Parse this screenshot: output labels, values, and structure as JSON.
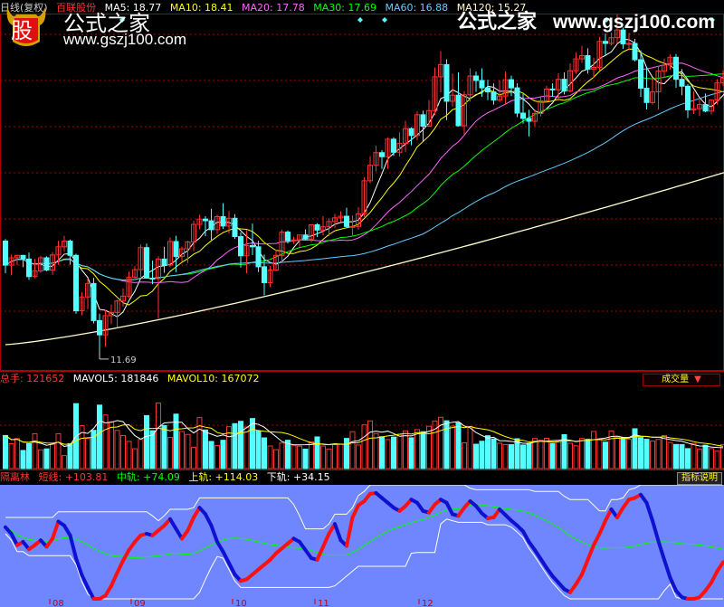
{
  "chart_header": {
    "period": "日线(复权)",
    "stock": "百联股份",
    "ma": [
      {
        "label": "MA5: 18.77",
        "color": "#ffffff"
      },
      {
        "label": "MA10: 18.41",
        "color": "#ffff00"
      },
      {
        "label": "MA20: 17.78",
        "color": "#ff66ff"
      },
      {
        "label": "MA30: 17.69",
        "color": "#00ff00"
      },
      {
        "label": "MA60: 16.88",
        "color": "#66ccff"
      },
      {
        "label": "MA120: 15.27",
        "color": "#ffffcc"
      }
    ]
  },
  "low_label": "11.69",
  "volume_header": {
    "total": "总手: 121652",
    "mavol5": "MAVOL5: 181846",
    "mavol10": "MAVOL10: 167072",
    "tab": "成交量"
  },
  "indicator_header": {
    "name": "隔离林",
    "short": "短线: +103.81",
    "mid": "中轨: +74.09",
    "upper": "上轨: +114.03",
    "lower": "下轨: +34.15",
    "help": "指标说明"
  },
  "x_ticks": [
    "08",
    "09",
    "10",
    "11",
    "12"
  ],
  "watermark": {
    "top_cn": "公式之家",
    "top_url": "www.gszj100.com",
    "logo": "股",
    "bottom_cn": "公式之家",
    "bottom_url": "www.gszj100.com"
  },
  "colors": {
    "up": "#ff3333",
    "down": "#54ffff",
    "grid": "#aa0000",
    "indicator_bg": "#6f86ff"
  },
  "chart_data": {
    "type": "candlestick",
    "ylim": [
      11.2,
      19.9
    ],
    "low_mark": 11.69,
    "ohlc": [
      [
        14.34,
        14.39,
        13.55,
        13.75
      ],
      [
        13.75,
        14.01,
        13.5,
        13.93
      ],
      [
        13.93,
        14.0,
        13.75,
        13.99
      ],
      [
        13.99,
        14.0,
        13.7,
        13.9
      ],
      [
        13.9,
        14.06,
        13.39,
        13.47
      ],
      [
        13.47,
        13.9,
        13.43,
        13.61
      ],
      [
        13.61,
        13.98,
        13.56,
        13.93
      ],
      [
        13.93,
        13.97,
        13.6,
        13.63
      ],
      [
        13.63,
        14.07,
        13.51,
        14.0
      ],
      [
        14.0,
        14.35,
        13.76,
        14.2
      ],
      [
        14.2,
        14.47,
        14.08,
        14.34
      ],
      [
        14.34,
        14.38,
        13.76,
        13.99
      ],
      [
        13.99,
        14.03,
        12.56,
        12.63
      ],
      [
        12.63,
        13.09,
        12.52,
        12.97
      ],
      [
        12.97,
        13.43,
        12.67,
        13.3
      ],
      [
        13.3,
        13.44,
        12.32,
        12.39
      ],
      [
        12.39,
        12.56,
        11.69,
        12.04
      ],
      [
        12.04,
        12.66,
        11.75,
        12.51
      ],
      [
        12.51,
        12.78,
        12.3,
        12.59
      ],
      [
        12.59,
        12.9,
        12.23,
        12.87
      ],
      [
        12.87,
        13.18,
        12.73,
        12.99
      ],
      [
        12.99,
        13.59,
        12.94,
        13.45
      ],
      [
        13.45,
        13.73,
        13.42,
        13.64
      ],
      [
        13.64,
        14.26,
        13.46,
        14.18
      ],
      [
        14.18,
        14.28,
        13.42,
        13.43
      ],
      [
        13.43,
        13.86,
        13.28,
        13.42
      ],
      [
        13.42,
        13.97,
        12.44,
        13.9
      ],
      [
        13.9,
        14.2,
        13.56,
        13.75
      ],
      [
        13.75,
        14.43,
        13.7,
        14.33
      ],
      [
        14.33,
        14.47,
        13.58,
        13.96
      ],
      [
        13.96,
        14.21,
        13.84,
        14.15
      ],
      [
        14.15,
        14.35,
        13.8,
        14.32
      ],
      [
        14.32,
        14.84,
        14.09,
        14.75
      ],
      [
        14.75,
        14.99,
        14.63,
        14.88
      ],
      [
        14.88,
        14.95,
        14.46,
        14.84
      ],
      [
        14.84,
        15.13,
        14.37,
        14.62
      ],
      [
        14.62,
        14.99,
        14.52,
        14.94
      ],
      [
        14.94,
        15.27,
        14.64,
        14.71
      ],
      [
        14.71,
        15.08,
        14.52,
        14.9
      ],
      [
        14.9,
        15.0,
        14.39,
        14.45
      ],
      [
        14.45,
        14.55,
        13.69,
        13.98
      ],
      [
        13.98,
        14.61,
        13.55,
        14.23
      ],
      [
        14.23,
        14.77,
        14.0,
        14.2
      ],
      [
        14.2,
        14.35,
        13.58,
        13.71
      ],
      [
        13.71,
        14.01,
        13.01,
        13.32
      ],
      [
        13.32,
        13.73,
        13.21,
        13.63
      ],
      [
        13.63,
        14.13,
        13.6,
        13.99
      ],
      [
        13.99,
        14.62,
        13.8,
        14.56
      ],
      [
        14.56,
        14.6,
        14.28,
        14.35
      ],
      [
        14.35,
        14.45,
        14.27,
        14.37
      ],
      [
        14.37,
        14.49,
        14.2,
        14.49
      ],
      [
        14.49,
        14.63,
        14.36,
        14.39
      ],
      [
        14.39,
        14.75,
        14.31,
        14.74
      ],
      [
        14.74,
        14.78,
        14.44,
        14.61
      ],
      [
        14.61,
        14.95,
        14.48,
        14.69
      ],
      [
        14.69,
        14.9,
        14.46,
        14.82
      ],
      [
        14.82,
        15.01,
        14.66,
        14.91
      ],
      [
        14.91,
        15.07,
        14.81,
        14.95
      ],
      [
        14.95,
        15.16,
        14.68,
        14.7
      ],
      [
        14.7,
        14.97,
        14.48,
        14.7
      ],
      [
        14.7,
        15.17,
        14.62,
        15.01
      ],
      [
        15.01,
        15.91,
        14.93,
        15.82
      ],
      [
        15.82,
        16.42,
        15.76,
        16.2
      ],
      [
        16.2,
        16.68,
        16.05,
        16.51
      ],
      [
        16.51,
        16.57,
        16.11,
        16.41
      ],
      [
        16.41,
        16.88,
        16.11,
        16.84
      ],
      [
        16.84,
        16.89,
        16.43,
        16.52
      ],
      [
        16.52,
        17.01,
        16.41,
        16.74
      ],
      [
        16.74,
        17.29,
        16.52,
        17.1
      ],
      [
        17.1,
        17.13,
        16.69,
        16.93
      ],
      [
        16.93,
        17.53,
        16.81,
        17.44
      ],
      [
        17.44,
        17.54,
        16.77,
        17.16
      ],
      [
        17.16,
        17.8,
        17.14,
        17.54
      ],
      [
        17.54,
        18.6,
        17.44,
        18.37
      ],
      [
        18.37,
        19.0,
        17.99,
        18.67
      ],
      [
        18.67,
        18.8,
        17.31,
        17.77
      ],
      [
        17.77,
        18.45,
        17.64,
        17.92
      ],
      [
        17.92,
        18.48,
        17.15,
        17.17
      ],
      [
        17.17,
        18.02,
        16.95,
        17.93
      ],
      [
        17.93,
        18.58,
        17.76,
        18.39
      ],
      [
        18.39,
        18.5,
        18.0,
        18.28
      ],
      [
        18.28,
        18.58,
        17.88,
        18.1
      ],
      [
        18.1,
        18.3,
        17.8,
        18.0
      ],
      [
        18.0,
        18.21,
        17.69,
        17.8
      ],
      [
        17.8,
        18.29,
        17.75,
        17.9
      ],
      [
        17.9,
        18.5,
        17.7,
        18.3
      ],
      [
        18.3,
        18.4,
        17.9,
        18.1
      ],
      [
        18.1,
        18.21,
        17.38,
        17.48
      ],
      [
        17.48,
        17.95,
        17.22,
        17.35
      ],
      [
        17.35,
        17.56,
        16.91,
        17.28
      ],
      [
        17.28,
        17.57,
        17.16,
        17.47
      ],
      [
        17.47,
        17.9,
        17.4,
        17.78
      ],
      [
        17.78,
        18.15,
        17.73,
        18.07
      ],
      [
        18.07,
        18.21,
        17.88,
        18.05
      ],
      [
        18.05,
        18.46,
        17.78,
        18.31
      ],
      [
        18.31,
        18.48,
        17.94,
        18.02
      ],
      [
        18.02,
        18.7,
        17.99,
        18.52
      ],
      [
        18.52,
        18.97,
        18.45,
        18.81
      ],
      [
        18.81,
        19.13,
        18.71,
        18.89
      ],
      [
        18.89,
        19.07,
        18.45,
        18.56
      ],
      [
        18.56,
        18.84,
        18.34,
        18.6
      ],
      [
        18.6,
        19.35,
        18.53,
        19.24
      ],
      [
        19.24,
        19.43,
        18.91,
        19.19
      ],
      [
        19.19,
        19.46,
        19.14,
        19.33
      ],
      [
        19.33,
        19.91,
        19.18,
        19.52
      ],
      [
        19.52,
        19.58,
        19.06,
        19.18
      ],
      [
        19.18,
        19.45,
        19.02,
        19.19
      ],
      [
        19.19,
        19.3,
        18.75,
        18.79
      ],
      [
        18.79,
        19.02,
        17.88,
        18.09
      ],
      [
        18.09,
        18.6,
        17.57,
        17.74
      ],
      [
        17.74,
        18.35,
        17.69,
        18.0
      ],
      [
        18.0,
        18.64,
        17.57,
        18.51
      ],
      [
        18.51,
        18.82,
        18.37,
        18.66
      ],
      [
        18.66,
        18.92,
        18.55,
        18.85
      ],
      [
        18.85,
        18.93,
        18.1,
        18.31
      ],
      [
        18.31,
        18.56,
        17.92,
        18.14
      ],
      [
        18.14,
        18.19,
        17.36,
        17.56
      ],
      [
        17.56,
        18.02,
        17.46,
        17.59
      ],
      [
        17.59,
        17.81,
        17.41,
        17.69
      ],
      [
        17.69,
        17.96,
        17.5,
        17.53
      ],
      [
        17.53,
        17.82,
        17.45,
        17.8
      ],
      [
        17.8,
        18.31,
        17.69,
        18.22
      ],
      [
        18.22,
        18.53,
        18.14,
        18.34
      ],
      [
        18.34,
        18.67,
        18.32,
        18.64
      ],
      [
        18.64,
        18.9,
        18.51,
        18.77
      ]
    ],
    "ma120_range": [
      11.8,
      16.1
    ],
    "volume": {
      "ylim": [
        0,
        420000
      ],
      "values": [
        167040,
        125560,
        151560,
        91480,
        126120,
        176000,
        94440,
        99480,
        122840,
        176000,
        65680,
        126120,
        327920,
        216720,
        151560,
        193080,
        320320,
        270680,
        234480,
        192600,
        166560,
        137240,
        100160,
        147320,
        267480,
        191200,
        330720,
        217240,
        157240,
        275000,
        187280,
        172400,
        107920,
        257520,
        195040,
        137080,
        116640,
        143040,
        211520,
        226880,
        238480,
        210000,
        252600,
        189280,
        155000,
        114120,
        95480,
        128840,
        143240,
        118280,
        113120,
        98160,
        135120,
        159960,
        113760,
        98760,
        120680,
        123440,
        152240,
        186360,
        118880,
        220680,
        240800,
        177120,
        160560,
        146400,
        159120,
        173280,
        190640,
        155520,
        196680,
        186120,
        213520,
        240120,
        259000,
        241320,
        214280,
        230840,
        130080,
        212400,
        123000,
        138120,
        166000,
        149600,
        128400,
        120800,
        121000,
        150680,
        119000,
        128000,
        152000,
        143200,
        153200,
        127000,
        137360,
        171200,
        128000,
        115000,
        152000,
        147800,
        187560,
        149400,
        133520,
        190600,
        158800,
        155200,
        147920,
        201000,
        156800,
        148000,
        139000,
        147200,
        166800,
        132000,
        122000,
        121440,
        101000,
        127000,
        99000,
        118000,
        101000,
        88000,
        121652
      ]
    },
    "indicator": {
      "ylim": [
        0,
        140
      ],
      "short": [
        88.0,
        80.0,
        66.0,
        70.0,
        61.0,
        66.0,
        72.0,
        64.0,
        74.0,
        95.0,
        90.0,
        78.0,
        50.0,
        29.0,
        14.0,
        0.0,
        0.0,
        4.0,
        16.0,
        32.0,
        47.0,
        60.0,
        70.0,
        78.0,
        80.0,
        78.0,
        84.0,
        90.0,
        98.0,
        86.0,
        74.0,
        84.0,
        100.0,
        112.0,
        104.0,
        90.0,
        70.0,
        58.0,
        44.0,
        30.0,
        22.0,
        24.0,
        30.0,
        36.0,
        42.0,
        48.0,
        56.0,
        62.0,
        68.0,
        74.0,
        70.0,
        60.0,
        50.0,
        48.0,
        64.0,
        80.0,
        92.0,
        72.0,
        65.0,
        100.0,
        115.0,
        120.0,
        129.0,
        130.0,
        124.0,
        118.0,
        112.0,
        108.0,
        114.0,
        122.0,
        118.0,
        108.0,
        106.0,
        116.0,
        122.0,
        118.0,
        104.0,
        102.0,
        112.0,
        120.0,
        114.0,
        105.0,
        99.0,
        100.0,
        110.0,
        103.0,
        96.0,
        90.0,
        83.0,
        70.0,
        60.0,
        49.0,
        38.0,
        28.0,
        20.0,
        12.0,
        8.0,
        18.0,
        30.0,
        48.0,
        66.0,
        80.0,
        96.0,
        110.0,
        100.0,
        112.0,
        122.0,
        124.0,
        128.0,
        118.0,
        96.0,
        71.0,
        48.0,
        26.0,
        10.0,
        2.0,
        0.0,
        0.0,
        2.0,
        10.0,
        20.0,
        34.0,
        45.0
      ]
    }
  }
}
